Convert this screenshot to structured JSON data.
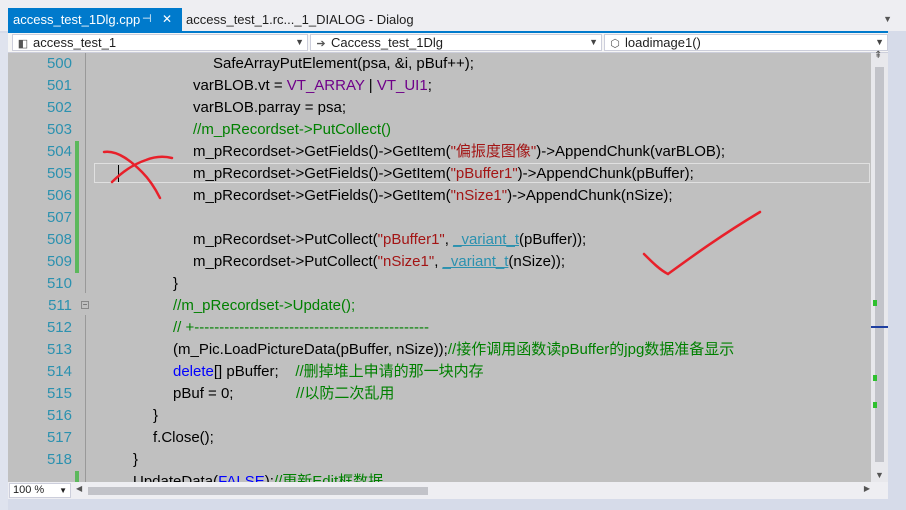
{
  "tabs": [
    {
      "label": "access_test_1Dlg.cpp",
      "active": true
    },
    {
      "label": "access_test_1.rc..._1_DIALOG - Dialog",
      "active": false
    }
  ],
  "icons": {
    "pin": "⊣",
    "close": "✕",
    "tab_scroll": "▼",
    "project": "◧",
    "klass": "➔",
    "method": "⬡",
    "dropdown": "▼",
    "scroll_up": "▲",
    "scroll_down": "▼",
    "scroll_left": "◀",
    "scroll_right": "▶",
    "split": "⇞"
  },
  "nav": {
    "project": "access_test_1",
    "klass": "Caccess_test_1Dlg",
    "method": "loadimage1()"
  },
  "editor": {
    "lines": [
      {
        "n": "500",
        "indent": 8
      },
      {
        "n": "501",
        "indent": 6
      },
      {
        "n": "502",
        "indent": 6
      },
      {
        "n": "503",
        "indent": 6
      },
      {
        "n": "504",
        "indent": 6
      },
      {
        "n": "505",
        "indent": 6
      },
      {
        "n": "506",
        "indent": 6
      },
      {
        "n": "507",
        "indent": 6
      },
      {
        "n": "508",
        "indent": 6
      },
      {
        "n": "509",
        "indent": 6
      },
      {
        "n": "510",
        "indent": 5
      },
      {
        "n": "511",
        "indent": 5
      },
      {
        "n": "512",
        "indent": 5
      },
      {
        "n": "513",
        "indent": 5
      },
      {
        "n": "514",
        "indent": 5
      },
      {
        "n": "515",
        "indent": 5
      },
      {
        "n": "516",
        "indent": 4
      },
      {
        "n": "517",
        "indent": 4
      },
      {
        "n": "518",
        "indent": 3
      },
      {
        "n": "",
        "indent": 3
      }
    ],
    "code": {
      "l500": "SafeArrayPutElement(psa, &i, pBuf++);",
      "l501a": "varBLOB.vt = ",
      "l501b": "VT_ARRAY",
      "l501c": " | ",
      "l501d": "VT_UI1",
      "l501e": ";",
      "l502": "varBLOB.parray = psa;",
      "l503": "//m_pRecordset->PutCollect()",
      "l504a": "m_pRecordset->GetFields()->GetItem(",
      "l504b": "\"偏振度图像\"",
      "l504c": ")->AppendChunk(varBLOB);",
      "l505a": "m_pRecordset->GetFields()->GetItem(",
      "l505b": "\"pBuffer1\"",
      "l505c": ")->AppendChunk(pBuffer);",
      "l506a": "m_pRecordset->GetFields()->GetItem(",
      "l506b": "\"nSize1\"",
      "l506c": ")->AppendChunk(nSize);",
      "l508a": "m_pRecordset->PutCollect(",
      "l508b": "\"pBuffer1\"",
      "l508c": ", ",
      "l508d": "_variant_t",
      "l508e": "(pBuffer));",
      "l509a": "m_pRecordset->PutCollect(",
      "l509b": "\"nSize1\"",
      "l509c": ", ",
      "l509d": "_variant_t",
      "l509e": "(nSize));",
      "l510": "}",
      "l511": "//m_pRecordset->Update();",
      "l512": "// +-----------------------------------------------",
      "l513a": "(m_Pic.LoadPictureData(pBuffer, nSize));",
      "l513b": "//接作调用函数读pBuffer的jpg数据准备显示",
      "l514a": "delete",
      "l514b": "[] pBuffer;    ",
      "l514c": "//删掉堆上申请的那一块内存",
      "l515a": "pBuf = 0;               ",
      "l515b": "//以防二次乱用",
      "l516": "}",
      "l517": "f.Close();",
      "l518": "}",
      "l519a": "UpdateData(",
      "l519b": "FALSE",
      "l519c": ");",
      "l519d": "//更新Edit框数据"
    }
  },
  "status": {
    "zoom": "100 %"
  },
  "colors": {
    "accent": "#007acc",
    "comment": "#008000",
    "string": "#a31515",
    "keyword": "#0000ff",
    "type": "#2b91af",
    "macro": "#6f008a",
    "ink": "#e8202a"
  }
}
